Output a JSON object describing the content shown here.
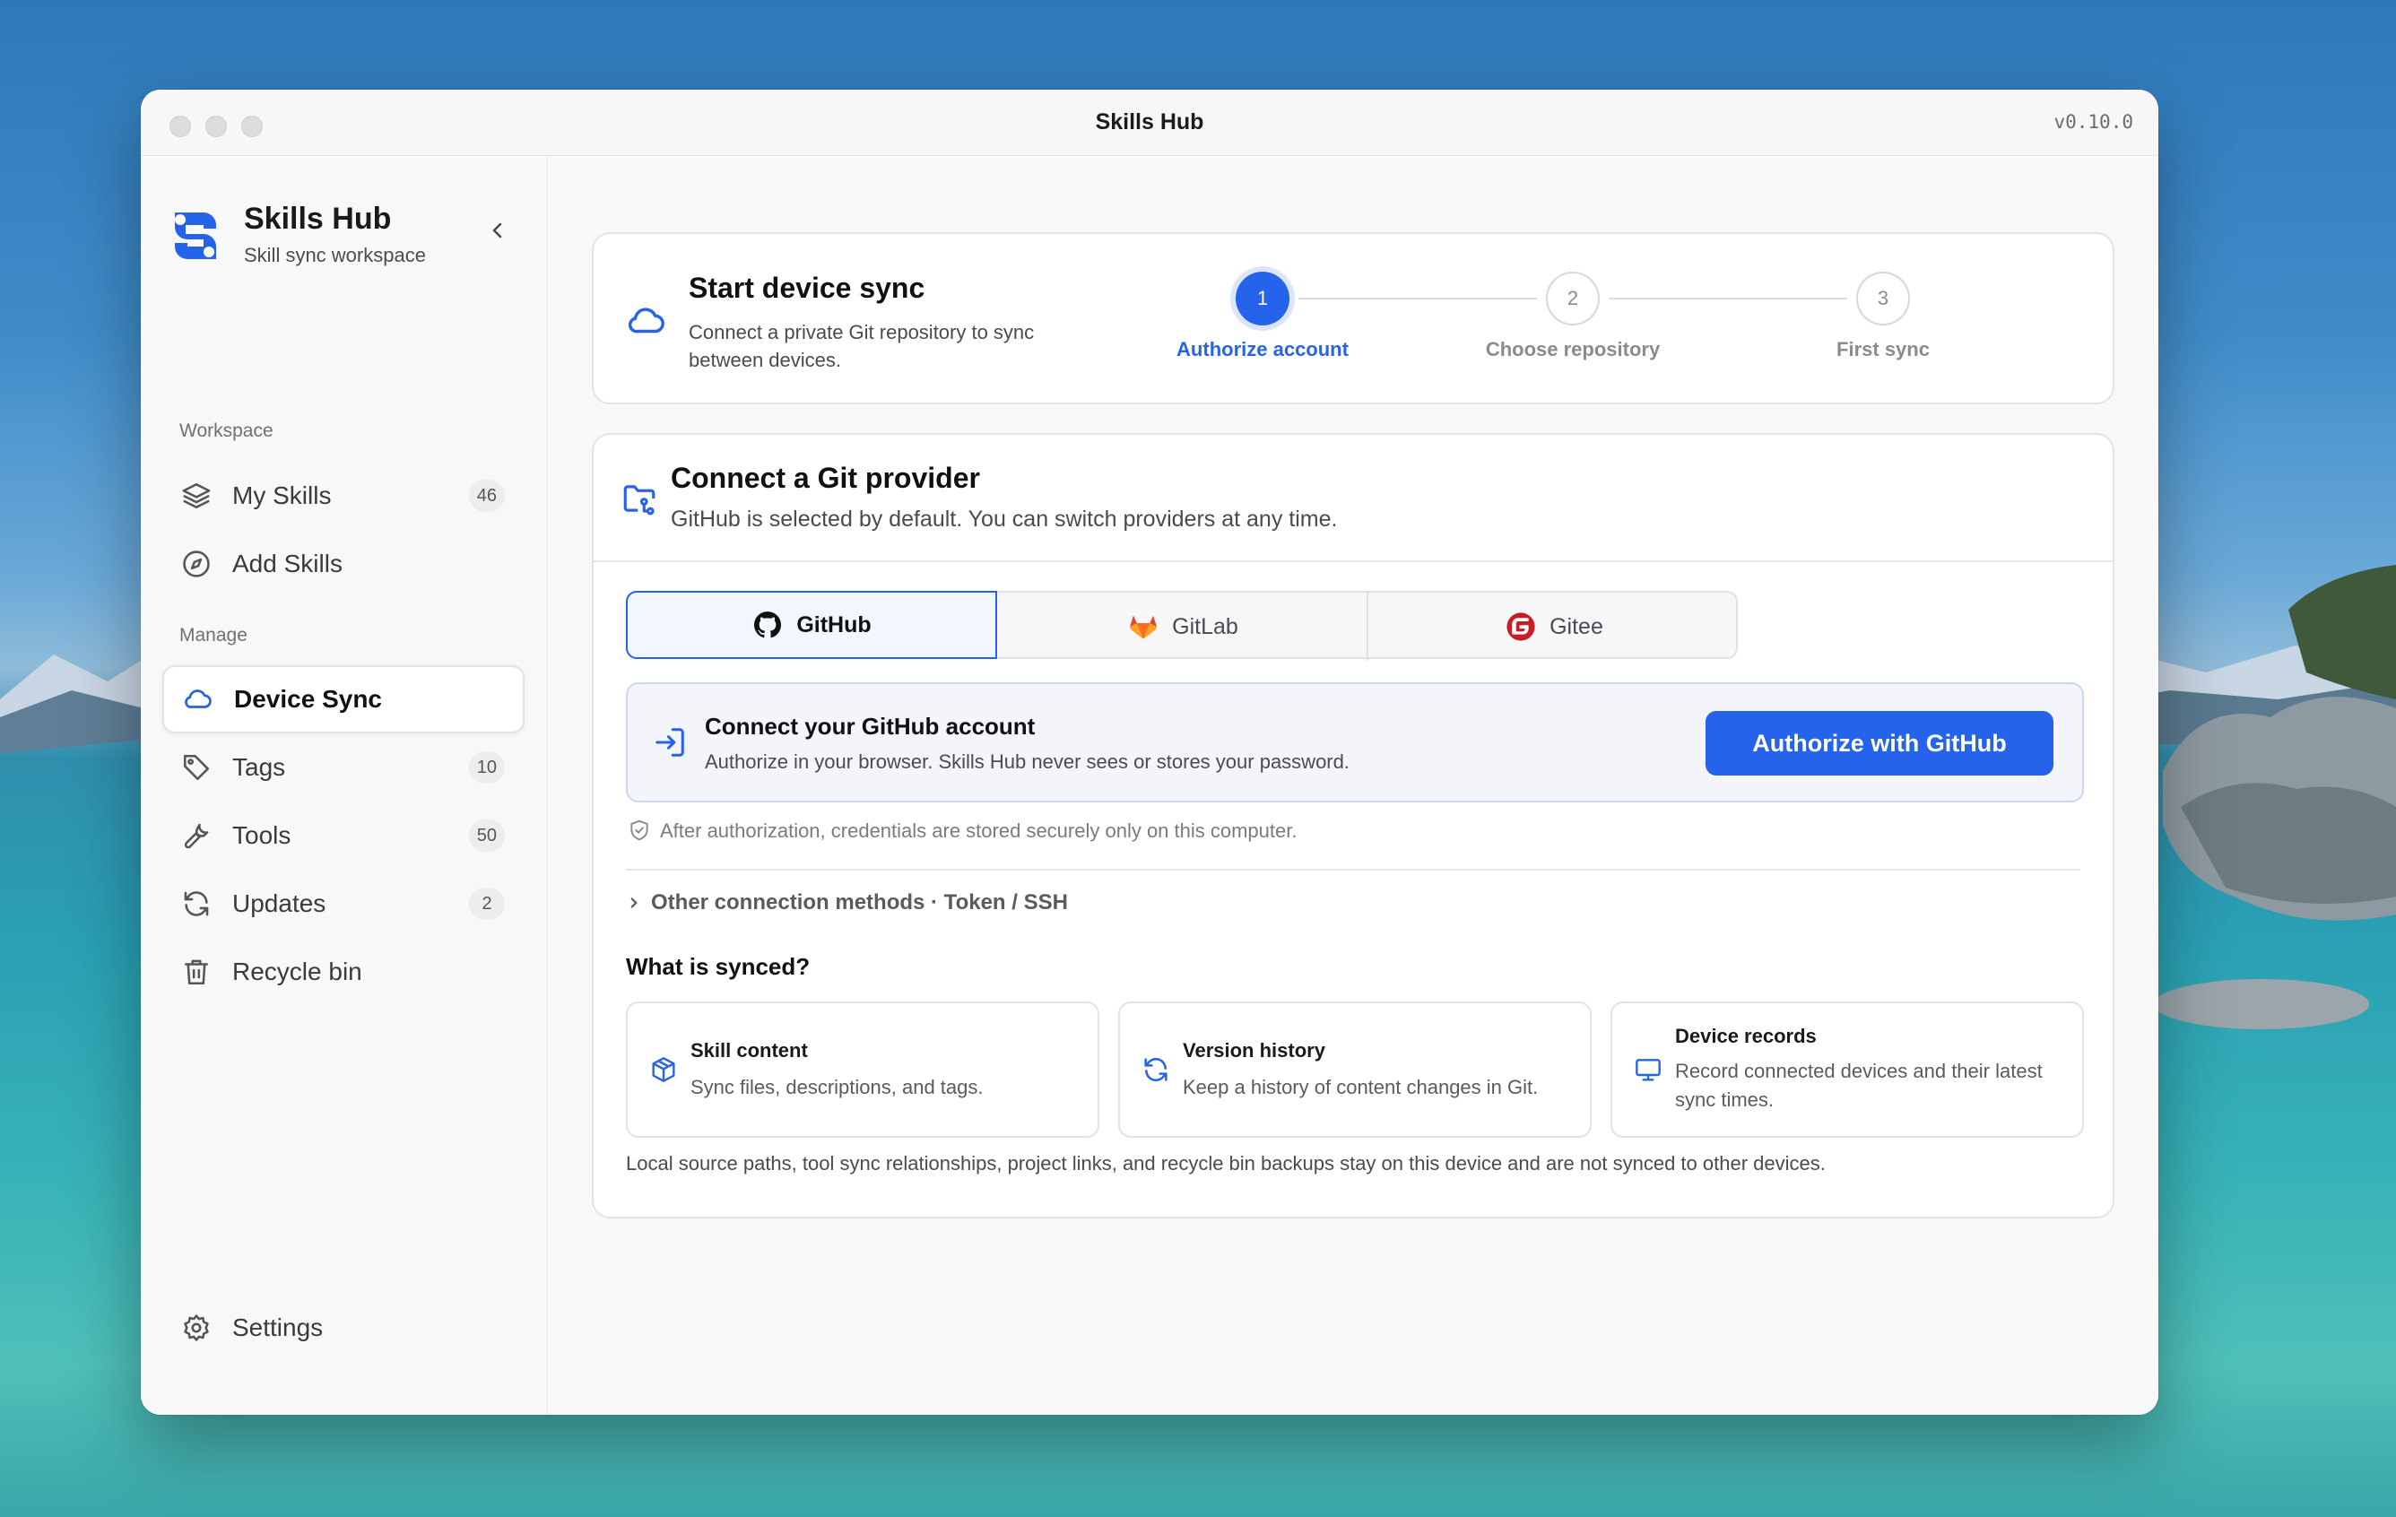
{
  "window": {
    "title": "Skills Hub",
    "version": "v0.10.0"
  },
  "sidebar": {
    "brand_title": "Skills Hub",
    "brand_subtitle": "Skill sync workspace",
    "workspace_label": "Workspace",
    "manage_label": "Manage",
    "workspace_items": [
      {
        "label": "My Skills",
        "count": "46",
        "icon": "layers-icon"
      },
      {
        "label": "Add Skills",
        "count": "",
        "icon": "compass-icon"
      }
    ],
    "manage_items": [
      {
        "label": "Device Sync",
        "count": "",
        "icon": "cloud-icon",
        "active": true
      },
      {
        "label": "Tags",
        "count": "10",
        "icon": "tag-icon"
      },
      {
        "label": "Tools",
        "count": "50",
        "icon": "wrench-icon"
      },
      {
        "label": "Updates",
        "count": "2",
        "icon": "refresh-icon"
      },
      {
        "label": "Recycle bin",
        "count": "",
        "icon": "trash-icon"
      }
    ],
    "settings_label": "Settings"
  },
  "sync_header": {
    "title": "Start device sync",
    "description": "Connect a private Git repository to sync between devices.",
    "steps": [
      {
        "number": "1",
        "label": "Authorize account",
        "state": "active"
      },
      {
        "number": "2",
        "label": "Choose repository",
        "state": "pending"
      },
      {
        "number": "3",
        "label": "First sync",
        "state": "pending"
      }
    ]
  },
  "provider": {
    "title": "Connect a Git provider",
    "subtitle": "GitHub is selected by default. You can switch providers at any time.",
    "tabs": [
      {
        "label": "GitHub",
        "icon": "github-icon",
        "selected": true
      },
      {
        "label": "GitLab",
        "icon": "gitlab-icon",
        "selected": false
      },
      {
        "label": "Gitee",
        "icon": "gitee-icon",
        "selected": false
      }
    ],
    "connect_title": "Connect your GitHub account",
    "connect_description": "Authorize in your browser. Skills Hub never sees or stores your password.",
    "authorize_button": "Authorize with GitHub",
    "security_note": "After authorization, credentials are stored securely only on this computer.",
    "other_methods": "Other connection methods · Token / SSH",
    "synced_heading": "What is synced?",
    "features": [
      {
        "title": "Skill content",
        "description": "Sync files, descriptions, and tags.",
        "icon": "package-icon"
      },
      {
        "title": "Version history",
        "description": "Keep a history of content changes in Git.",
        "icon": "history-icon"
      },
      {
        "title": "Device records",
        "description": "Record connected devices and their latest sync times.",
        "icon": "monitor-icon"
      }
    ],
    "footer_note": "Local source paths, tool sync relationships, project links, and recycle bin backups stay on this device and are not synced to other devices."
  },
  "colors": {
    "accent": "#2563eb",
    "gitlab": "#e24329",
    "gitee": "#c71d23"
  }
}
